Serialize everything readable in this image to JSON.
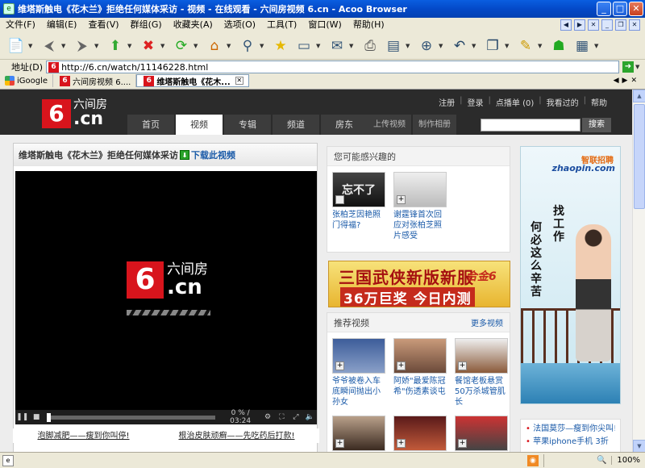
{
  "window": {
    "title": "维塔斯触电《花木兰》拒绝任何媒体采访 - 视频 - 在线观看 - 六间房视频 6.cn - Acoo Browser",
    "app_icon": "acoo-browser-icon",
    "controls": [
      "minimize",
      "maximize",
      "close"
    ]
  },
  "menu": {
    "items": [
      "文件(F)",
      "编辑(E)",
      "查看(V)",
      "群组(G)",
      "收藏夹(A)",
      "选项(O)",
      "工具(T)",
      "窗口(W)",
      "帮助(H)"
    ]
  },
  "toolbar": {
    "icons": [
      "new-page-icon",
      "back-icon",
      "forward-icon",
      "up-icon",
      "stop-icon",
      "refresh-icon",
      "home-icon",
      "search-icon",
      "favorites-star-icon",
      "layout-icon",
      "mail-icon",
      "print-icon",
      "display-icon",
      "zoom-icon",
      "undo-icon",
      "window-icon",
      "clean-broom-icon",
      "robot-icon",
      "notes-icon"
    ]
  },
  "address": {
    "label": "地址(D)",
    "url": "http://6.cn/watch/11146228.html"
  },
  "tabs": [
    {
      "label": "iGoogle",
      "icon": "google-icon"
    },
    {
      "label": "六间房视频 6....",
      "icon": "6cn-icon"
    },
    {
      "label": "维塔斯触电《花木...",
      "icon": "6cn-icon",
      "active": true
    }
  ],
  "site": {
    "logo_text": "六间房",
    "logo_domain": ".cn",
    "logo_number": "6",
    "top_links": [
      "注册",
      "登录",
      "点播单 (0)",
      "我看过的",
      "帮助"
    ],
    "nav": [
      "首页",
      "视频",
      "专辑",
      "频道",
      "房东"
    ],
    "nav_active": "视频",
    "nav_secondary": [
      "上传视频",
      "制作相册"
    ],
    "search_button": "搜索"
  },
  "player": {
    "title": "维塔斯触电《花木兰》拒绝任何媒体采访",
    "download_label": "下载此视频",
    "time": "0 % / 03:24",
    "progress": 0,
    "logo_text": "六间房",
    "logo_domain": ".cn",
    "logo_number": "6",
    "links": [
      "泡脚减肥——瘦到你叫停!",
      "根治皮肤顽癣——先吃药后打款!"
    ]
  },
  "interest": {
    "heading": "您可能感兴趣的",
    "items": [
      {
        "caption": "张柏芝因艳照门得福?",
        "thumb_text": "忘不了"
      },
      {
        "caption": "谢霆锋首次回应对张柏芝照片感受"
      }
    ]
  },
  "banner": {
    "line1": "三国武侠新版新服",
    "line2": "36万巨奖 今日内测",
    "mascot": "合金6"
  },
  "recommended": {
    "heading": "推荐视频",
    "more": "更多视频",
    "items": [
      {
        "caption": "爷爷被卷入车底瞬间抛出小孙女"
      },
      {
        "caption": "阿娇\"最爱陈冠希\"伤透素谈屯"
      },
      {
        "caption": "餐馆老板悬赏50万杀城管肌长"
      }
    ]
  },
  "side_ad": {
    "brand_cn": "智联招聘",
    "brand_en": "zhaopin.com",
    "slogan1": "找工作",
    "slogan2": "何必这么辛苦"
  },
  "news": [
    "法国莫莎—瘦到你尖叫!",
    "苹果iphone手机 3折"
  ],
  "status": {
    "zoom": "100%"
  }
}
